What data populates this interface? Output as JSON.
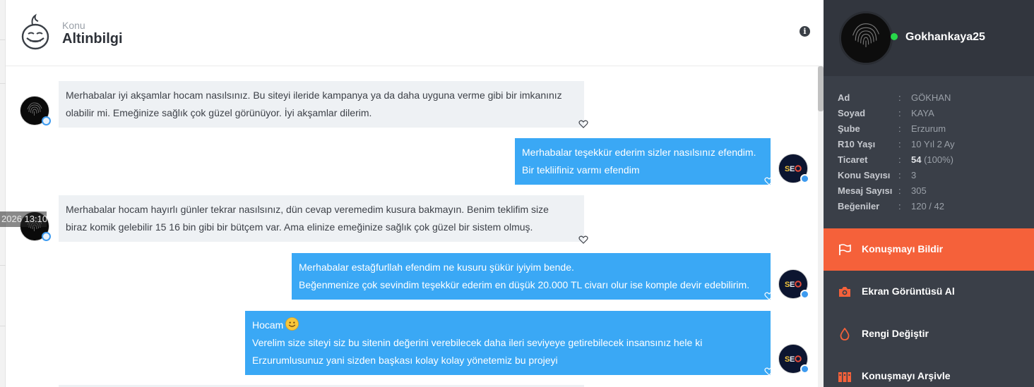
{
  "header": {
    "kicker": "Konu",
    "title": "Altinbilgi",
    "info_icon": "info-icon"
  },
  "background": {
    "time_fragment": "2026 13:10"
  },
  "messages": [
    {
      "direction": "in",
      "lines": [
        "Merhabalar iyi akşamlar hocam nasılsınız. Bu siteyi ileride kampanya ya da daha uyguna verme gibi bir imkanınız",
        "olabilir mi. Emeğinize sağlık çok güzel görünüyor. İyi akşamlar dilerim."
      ]
    },
    {
      "direction": "out",
      "lines": [
        "Merhabalar teşekkür ederim sizler nasılsınız efendim.",
        "Bir tekliifiniz varmı efendim"
      ]
    },
    {
      "direction": "in",
      "lines": [
        "Merhabalar hocam hayırlı günler tekrar nasılsınız, dün cevap veremedim kusura bakmayın. Benim teklifim size",
        "biraz komik gelebilir 15 16 bin gibi bir bütçem var. Ama elinize emeğinize sağlık çok güzel bir sistem olmuş."
      ]
    },
    {
      "direction": "out",
      "lines": [
        "Merhabalar estağfurllah efendim ne kusuru şükür iyiyim bende.",
        "Beğenmenize çok sevindim teşekkür ederim en düşük 20.000 TL civarı olur ise komple devir edebilirim."
      ]
    },
    {
      "direction": "out",
      "lines": [
        "Hocam",
        "Verelim size siteyi siz bu sitenin değerini verebilecek daha ileri seviyeye getirebilecek insansınız hele ki",
        "Erzurumlusunuz yani sizden başkası kolay kolay yönetemiz bu projeyi"
      ],
      "emoji": "smile-emoji"
    }
  ],
  "avatars": {
    "other_avatar_text": "SEO"
  },
  "sidebar": {
    "username": "Gokhankaya25",
    "status": "online",
    "details": [
      {
        "key": "Ad",
        "value": "GÖKHAN"
      },
      {
        "key": "Soyad",
        "value": "KAYA"
      },
      {
        "key": "Şube",
        "value": "Erzurum"
      },
      {
        "key": "R10 Yaşı",
        "value": "10 Yıl 2 Ay"
      },
      {
        "key": "Ticaret",
        "value_bold": "54",
        "value": " (100%)"
      },
      {
        "key": "Konu Sayısı",
        "value": "3"
      },
      {
        "key": "Mesaj Sayısı",
        "value": "305"
      },
      {
        "key": "Beğeniler",
        "value": "120 / 42"
      }
    ],
    "separator": ":",
    "actions": [
      {
        "label": "Konuşmayı Bildir",
        "icon": "flag-icon",
        "active": true
      },
      {
        "label": "Ekran Görüntüsü Al",
        "icon": "camera-icon",
        "active": false
      },
      {
        "label": "Rengi Değiştir",
        "icon": "drop-icon",
        "active": false
      },
      {
        "label": "Konuşmayı Arşivle",
        "icon": "archive-icon",
        "active": false
      }
    ]
  },
  "colors": {
    "incoming_bubble": "#eef1f4",
    "outgoing_bubble": "#3aa8f5",
    "sidebar_bg": "#3a3f48",
    "accent": "#f5613a",
    "online": "#27d84a"
  }
}
